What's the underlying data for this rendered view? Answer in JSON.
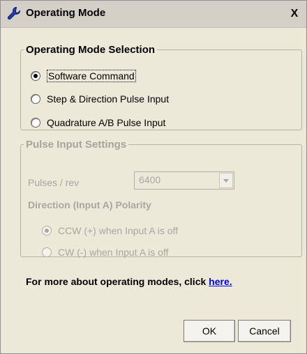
{
  "window": {
    "title": "Operating Mode",
    "close_glyph": "X",
    "icon": "wrench-icon"
  },
  "mode_group": {
    "legend": "Operating Mode Selection",
    "options": [
      {
        "label": "Software Command",
        "checked": true
      },
      {
        "label": "Step & Direction Pulse Input",
        "checked": false
      },
      {
        "label": "Quadrature A/B Pulse Input",
        "checked": false
      }
    ]
  },
  "pulse_group": {
    "legend": "Pulse Input Settings",
    "pulses_label": "Pulses / rev",
    "pulses_value": "6400",
    "polarity_label": "Direction (Input A) Polarity",
    "polarity_options": [
      {
        "label": "CCW (+) when Input A is off",
        "checked": true
      },
      {
        "label": "CW (-) when Input A is off",
        "checked": false
      }
    ],
    "disabled": true
  },
  "info": {
    "text": "For more about operating modes, click ",
    "link_text": "here."
  },
  "buttons": {
    "ok": "OK",
    "cancel": "Cancel"
  },
  "colors": {
    "dialog_bg": "#ece9d8",
    "disabled_text": "#a9a79e",
    "link": "#0000ee"
  }
}
